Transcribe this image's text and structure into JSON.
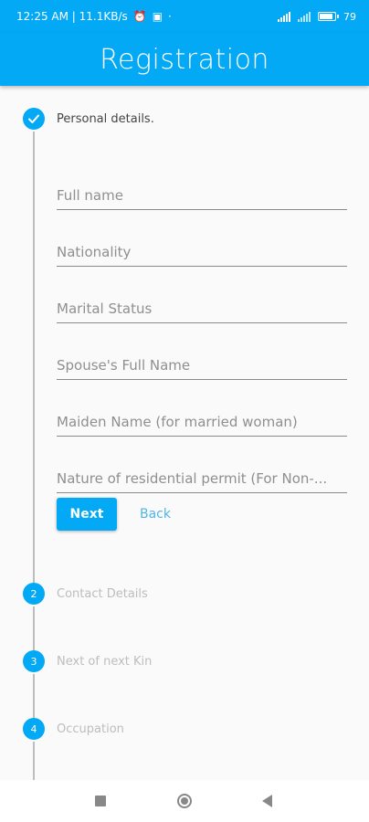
{
  "status_bar": {
    "time_info": "12:25 AM | 11.1KB/s",
    "battery": "79"
  },
  "app_bar": {
    "title": "Registration"
  },
  "steps": [
    {
      "number": "",
      "label": "Personal details.",
      "state": "active"
    },
    {
      "number": "2",
      "label": "Contact Details",
      "state": "inactive"
    },
    {
      "number": "3",
      "label": "Next of next Kin",
      "state": "inactive"
    },
    {
      "number": "4",
      "label": "Occupation",
      "state": "inactive"
    }
  ],
  "form": {
    "fields": [
      {
        "placeholder": "Full name",
        "value": ""
      },
      {
        "placeholder": "Nationality",
        "value": ""
      },
      {
        "placeholder": "Marital Status",
        "value": ""
      },
      {
        "placeholder": "Spouse's Full Name",
        "value": ""
      },
      {
        "placeholder": "Maiden Name (for married woman)",
        "value": ""
      },
      {
        "placeholder": "Nature of residential permit (For Non-...",
        "value": ""
      }
    ],
    "next_label": "Next",
    "back_label": "Back"
  },
  "colors": {
    "primary": "#03a9f4",
    "inactive": "#bdbdbd"
  },
  "icons": {
    "step1": "check-icon",
    "nav": [
      "square-icon",
      "home-circle-icon",
      "back-triangle-icon"
    ]
  }
}
